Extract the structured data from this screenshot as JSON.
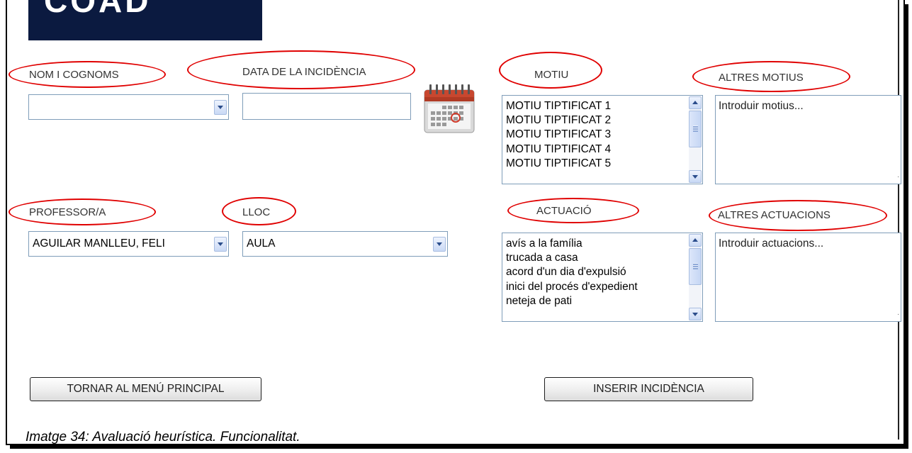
{
  "form": {
    "labels": {
      "nom": "NOM I COGNOMS",
      "data": "DATA DE LA INCIDÈNCIA",
      "motiu": "MOTIU",
      "altres_motius": "ALTRES MOTIUS",
      "professor": "PROFESSOR/A",
      "lloc": "LLOC",
      "actuacio": "ACTUACIÓ",
      "altres_actuacions": "ALTRES ACTUACIONS"
    },
    "nom_value": "",
    "data_value": "",
    "professor_value": "AGUILAR MANLLEU, FELI",
    "lloc_value": "AULA",
    "motius": [
      "MOTIU TIPTIFICAT 1",
      "MOTIU TIPTIFICAT 2",
      "MOTIU TIPTIFICAT 3",
      "MOTIU TIPTIFICAT 4",
      "MOTIU TIPTIFICAT 5"
    ],
    "actuacions": [
      "avís a la família",
      "trucada a casa",
      "acord d'un dia d'expulsió",
      "inici del procés d'expedient",
      "neteja de pati"
    ],
    "altres_motius_placeholder": "Introduir motius...",
    "altres_actuacions_placeholder": "Introduir actuacions..."
  },
  "buttons": {
    "tornar": "TORNAR AL MENÚ PRINCIPAL",
    "inserir": "INSERIR INCIDÈNCIA"
  },
  "caption": "Imatge 34: Avaluació heurística. Funcionalitat.",
  "logo_text": "COAD",
  "icons": {
    "calendar": "calendar-icon",
    "dropdown": "chevron-down-icon"
  },
  "colors": {
    "annotation_red": "#e00000",
    "logo_bg": "#0b1a40",
    "field_border": "#7f9db9"
  }
}
